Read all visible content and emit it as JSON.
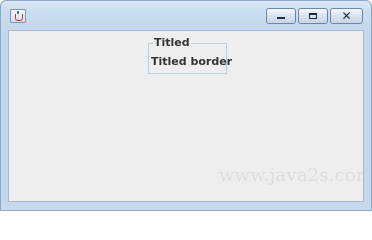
{
  "window": {
    "icon": "java-cup-icon",
    "controls": {
      "minimize_icon": "minimize-icon",
      "maximize_icon": "maximize-icon",
      "close_glyph": "✕"
    }
  },
  "panel": {
    "border_title": "Titled",
    "label": "Titled border"
  },
  "watermark": "www.java2s.com",
  "colors": {
    "frame": "#c4d7eb",
    "content_background": "#eeeeee",
    "border_line": "#b8cfe5",
    "text": "#333333",
    "watermark": "#dcdcdc"
  }
}
